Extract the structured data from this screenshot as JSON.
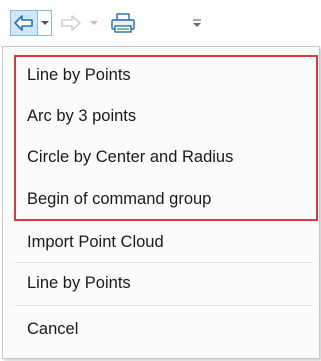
{
  "toolbar": {
    "icons": {
      "undo": "undo-arrow-icon",
      "undo_dropdown": "chevron-down-icon",
      "redo": "redo-arrow-icon",
      "redo_dropdown": "chevron-down-icon",
      "print": "printer-icon",
      "customize": "customize-toolbar-icon"
    }
  },
  "menu": {
    "highlight_color": "#e0353f",
    "items": [
      {
        "label": "Line by Points"
      },
      {
        "label": "Arc by 3 points"
      },
      {
        "label": "Circle by Center and Radius"
      },
      {
        "label": "Begin of command group"
      },
      {
        "label": "Import Point Cloud"
      },
      {
        "label": "Line by Points"
      },
      {
        "label": "Cancel"
      }
    ]
  }
}
